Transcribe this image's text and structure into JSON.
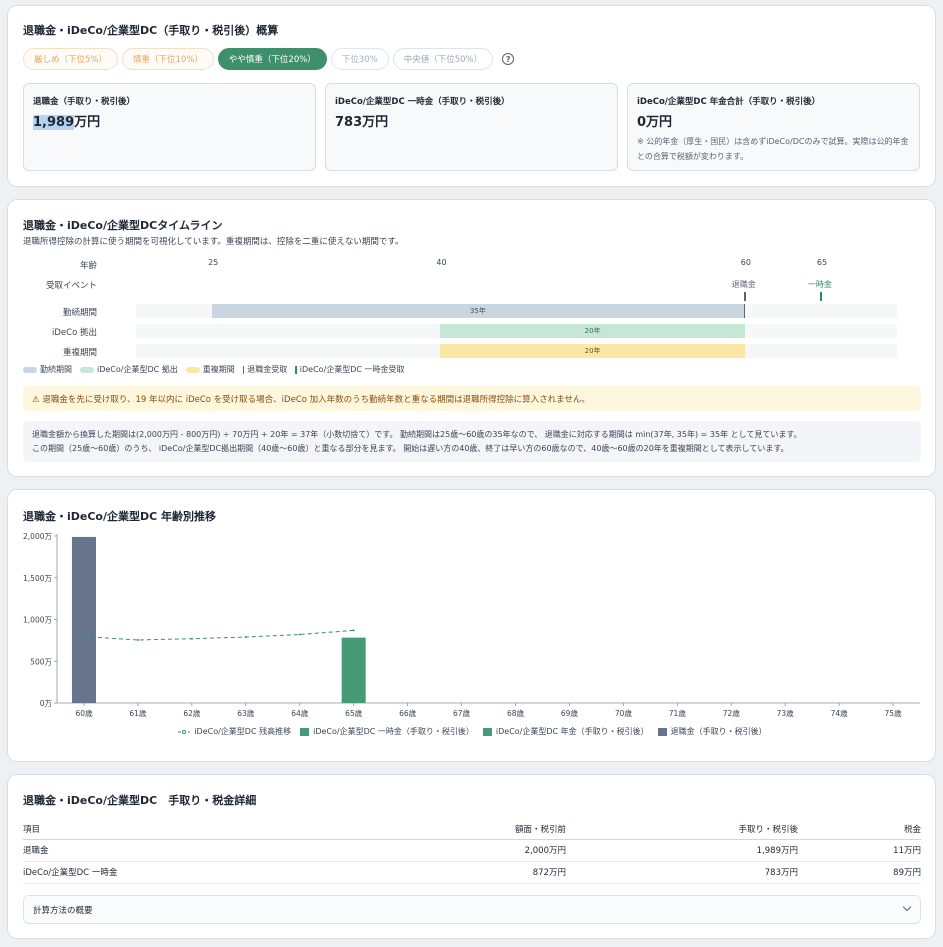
{
  "summary": {
    "title": "退職金・iDeCo/企業型DC（手取り・税引後）概算",
    "pills": [
      "厳しめ（下位5%）",
      "慎重（下位10%）",
      "やや慎重（下位20%）",
      "下位30%",
      "中央値（下位50%）"
    ],
    "selected_pill": "やや慎重（下位20%）",
    "help_icon": "question-circle-icon",
    "stats": [
      {
        "label": "退職金（手取り・税引後）",
        "value_selected": "1,989",
        "value_rest": "万円"
      },
      {
        "label": "iDeCo/企業型DC 一時金（手取り・税引後）",
        "value": "783万円"
      },
      {
        "label": "iDeCo/企業型DC 年金合計（手取り・税引後）",
        "value": "0万円",
        "note": "※ 公的年金（厚生・国民）は含めずiDeCo/DCのみで試算。実際は公的年金との合算で税額が変わります。"
      }
    ]
  },
  "timeline": {
    "title": "退職金・iDeCo/企業型DCタイムライン",
    "subtitle": "退職所得控除の計算に使う期間を可視化しています。重複期間は、控除を二重に使えない期間です。",
    "row_labels": {
      "age": "年齢",
      "event": "受取イベント",
      "service": "勤続期間",
      "ideco": "iDeCo 拠出",
      "overlap": "重複期間"
    },
    "axis_start": 20,
    "axis_end": 70,
    "ticks": [
      "25",
      "40",
      "60",
      "65"
    ],
    "events": [
      {
        "label": "退職金",
        "age": 60,
        "color": "#5b6573"
      },
      {
        "label": "一時金",
        "age": 65,
        "color": "#2e8b62"
      }
    ],
    "bars": {
      "service": {
        "start": 25,
        "end": 60,
        "label": "35年"
      },
      "ideco": {
        "start": 40,
        "end": 60,
        "label": "20年"
      },
      "overlap": {
        "start": 40,
        "end": 60,
        "label": "20年"
      }
    },
    "legend": [
      "勤続期間",
      "iDeCo/企業型DC 拠出",
      "重複期間",
      "退職金受取",
      "iDeCo/企業型DC 一時金受取"
    ],
    "warning": "⚠ 退職金を先に受け取り、19 年以内に iDeCo を受け取る場合、iDeCo 加入年数のうち勤続年数と重なる期間は退職所得控除に算入されません。",
    "explain_lines": [
      "退職金額から換算した期間は(2,000万円 - 800万円) ÷ 70万円 + 20年 = 37年（小数切捨て）です。 勤続期間は25歳〜60歳の35年なので、 退職金に対応する期間は min(37年, 35年) = 35年 として見ています。",
      "この期間（25歳〜60歳）のうち、 iDeCo/企業型DC拠出期間（40歳〜60歳）と重なる部分を見ます。 開始は遅い方の40歳、終了は早い方の60歳なので、40歳〜60歳の20年を重複期間として表示しています。"
    ]
  },
  "chart": {
    "title": "退職金・iDeCo/企業型DC 年齢別推移",
    "legend": [
      "iDeCo/企業型DC 残高推移",
      "iDeCo/企業型DC 一時金（手取り・税引後）",
      "iDeCo/企業型DC 年金（手取り・税引後）",
      "退職金（手取り・税引後）"
    ]
  },
  "chart_data": {
    "type": "bar",
    "categories": [
      "60歳",
      "61歳",
      "62歳",
      "63歳",
      "64歳",
      "65歳",
      "66歳",
      "67歳",
      "68歳",
      "69歳",
      "70歳",
      "71歳",
      "72歳",
      "73歳",
      "74歳",
      "75歳"
    ],
    "y_ticks": [
      "0万",
      "500万",
      "1,000万",
      "1,500万",
      "2,000万"
    ],
    "ylim": [
      0,
      2000
    ],
    "series": [
      {
        "name": "退職金（手取り・税引後）",
        "type": "bar",
        "color": "#66758b",
        "values": [
          1989,
          0,
          0,
          0,
          0,
          0,
          0,
          0,
          0,
          0,
          0,
          0,
          0,
          0,
          0,
          0
        ]
      },
      {
        "name": "iDeCo/企業型DC 一時金（手取り・税引後）",
        "type": "bar",
        "color": "#479a76",
        "values": [
          0,
          0,
          0,
          0,
          0,
          783,
          0,
          0,
          0,
          0,
          0,
          0,
          0,
          0,
          0,
          0
        ]
      },
      {
        "name": "iDeCo/企業型DC 年金（手取り・税引後）",
        "type": "bar",
        "color": "#479a76",
        "values": [
          0,
          0,
          0,
          0,
          0,
          0,
          0,
          0,
          0,
          0,
          0,
          0,
          0,
          0,
          0,
          0
        ]
      },
      {
        "name": "iDeCo/企業型DC 残高推移",
        "type": "line",
        "color": "#3a8f6a",
        "points": [
          [
            0,
            795
          ],
          [
            1,
            755
          ],
          [
            2,
            770
          ],
          [
            3,
            790
          ],
          [
            4,
            820
          ],
          [
            5,
            870
          ]
        ]
      }
    ]
  },
  "detail": {
    "title": "退職金・iDeCo/企業型DC　手取り・税金詳細",
    "headers": [
      "項目",
      "額面・税引前",
      "手取り・税引後",
      "税金"
    ],
    "rows": [
      [
        "退職金",
        "2,000万円",
        "1,989万円",
        "11万円"
      ],
      [
        "iDeCo/企業型DC 一時金",
        "872万円",
        "783万円",
        "89万円"
      ]
    ],
    "accordion_label": "計算方法の概要"
  }
}
